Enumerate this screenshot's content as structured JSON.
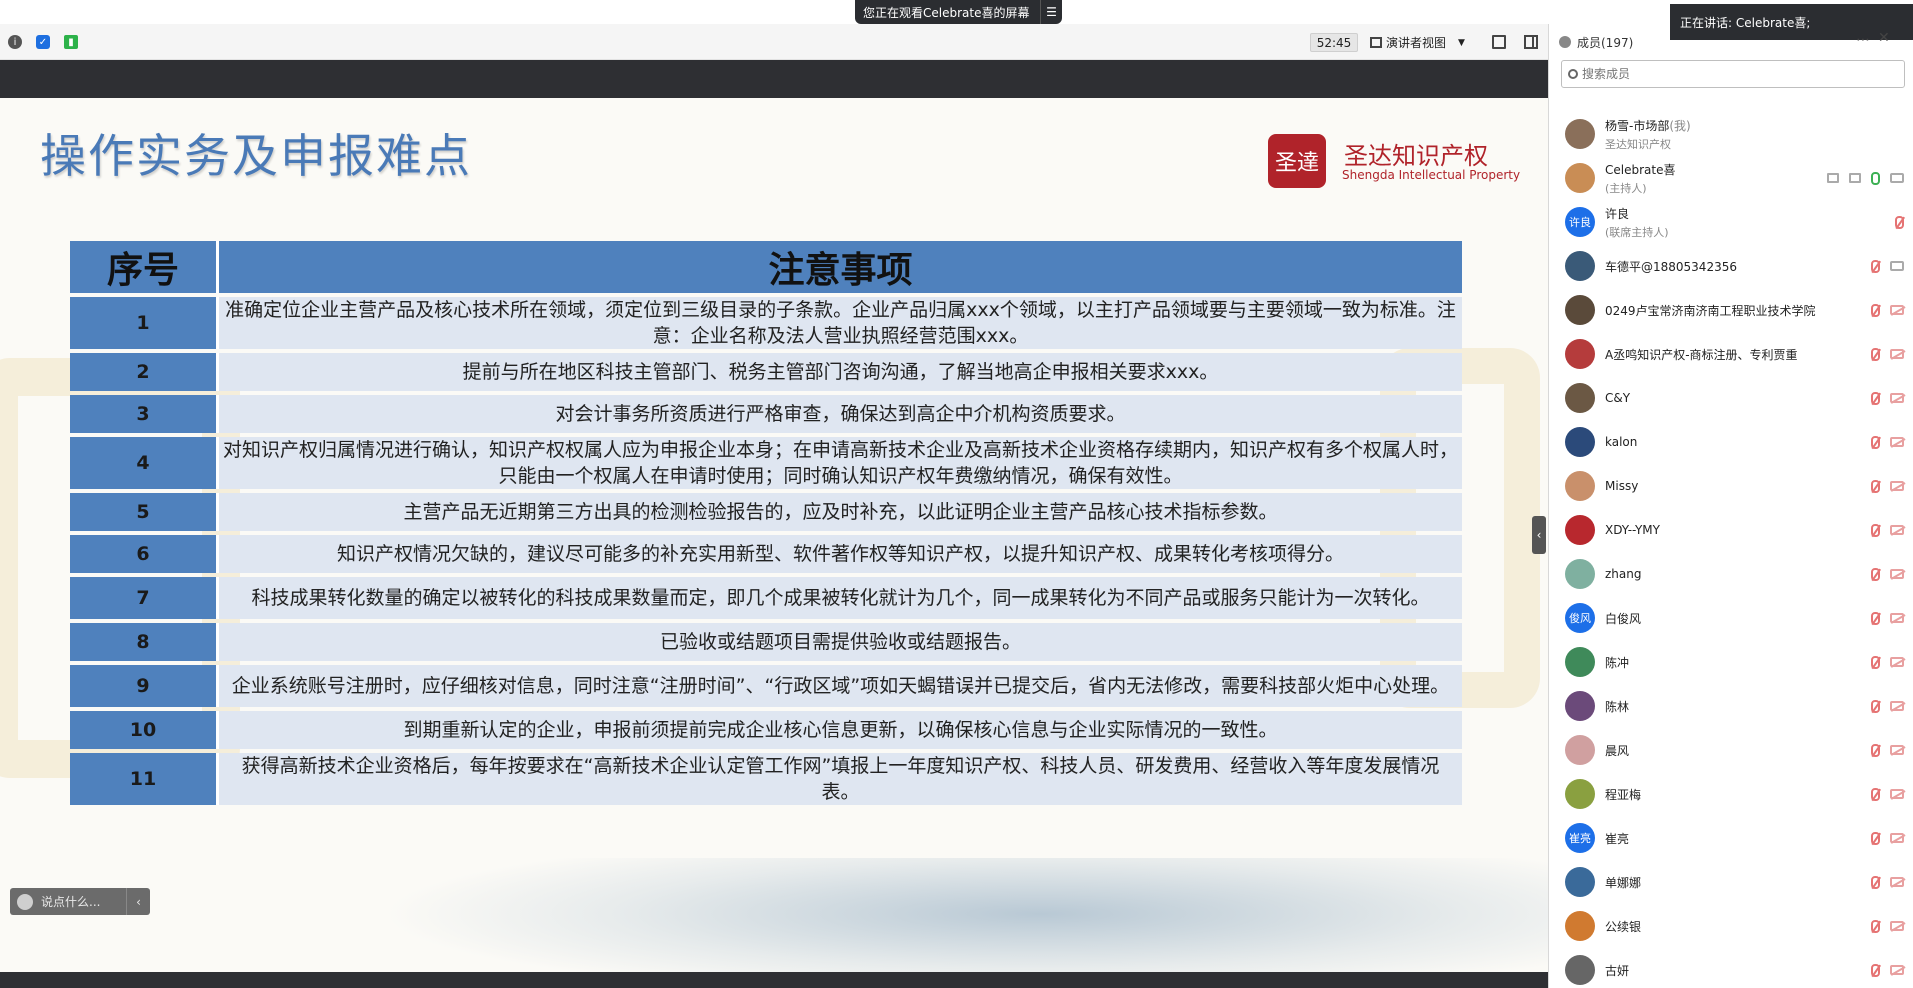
{
  "banner": {
    "text": "您正在观看Celebrate喜的屏幕"
  },
  "toolbar": {
    "timer": "52:45",
    "view_mode": "演讲者视图"
  },
  "slide": {
    "title": "操作实务及申报难点",
    "logo_cn": "圣达知识产权",
    "logo_en": "Shengda Intellectual Property",
    "logo_seal": "圣達",
    "table": {
      "headers": [
        "序号",
        "注意事项"
      ],
      "rows": [
        {
          "no": "1",
          "text": "准确定位企业主营产品及核心技术所在领域，须定位到三级目录的子条款。企业产品归属xxx个领域，以主打产品领域要与主要领域一致为标准。注意：企业名称及法人营业执照经营范围xxx。"
        },
        {
          "no": "2",
          "text": "提前与所在地区科技主管部门、税务主管部门咨询沟通，了解当地高企申报相关要求xxx。"
        },
        {
          "no": "3",
          "text": "对会计事务所资质进行严格审查，确保达到高企中介机构资质要求。"
        },
        {
          "no": "4",
          "text": "对知识产权归属情况进行确认，知识产权权属人应为申报企业本身；在申请高新技术企业及高新技术企业资格存续期内，知识产权有多个权属人时，只能由一个权属人在申请时使用；同时确认知识产权年费缴纳情况，确保有效性。"
        },
        {
          "no": "5",
          "text": "主营产品无近期第三方出具的检测检验报告的，应及时补充，以此证明企业主营产品核心技术指标参数。"
        },
        {
          "no": "6",
          "text": "知识产权情况欠缺的，建议尽可能多的补充实用新型、软件著作权等知识产权，以提升知识产权、成果转化考核项得分。"
        },
        {
          "no": "7",
          "text": "科技成果转化数量的确定以被转化的科技成果数量而定，即几个成果被转化就计为几个，同一成果转化为不同产品或服务只能计为一次转化。"
        },
        {
          "no": "8",
          "text": "已验收或结题项目需提供验收或结题报告。"
        },
        {
          "no": "9",
          "text": "企业系统账号注册时，应仔细核对信息，同时注意“注册时间”、“行政区域”项如天蝎错误并已提交后，省内无法修改，需要科技部火炬中心处理。"
        },
        {
          "no": "10",
          "text": "到期重新认定的企业，申报前须提前完成企业核心信息更新，以确保核心信息与企业实际情况的一致性。"
        },
        {
          "no": "11",
          "text": "获得高新技术企业资格后，每年按要求在“高新技术企业认定管工作网”填报上一年度知识产权、科技人员、研发费用、经营收入等年度发展情况表。"
        }
      ]
    }
  },
  "chat": {
    "placeholder": "说点什么..."
  },
  "sidebar": {
    "speaking": "正在讲话: Celebrate喜;",
    "title": "成员(197)",
    "search_placeholder": "搜索成员",
    "members": [
      {
        "name": "杨雪-市场部",
        "tag": "(我)",
        "sub": "圣达知识产权",
        "avatar": "",
        "mic": "none",
        "cam": "none"
      },
      {
        "name": "Celebrate喜",
        "tag": "",
        "sub": "(主持人)",
        "avatar": "",
        "mic": "on",
        "cam": "gray"
      },
      {
        "name": "许良",
        "tag": "",
        "sub": "(联席主持人)",
        "avatar": "许良",
        "mic": "off",
        "cam": "none"
      },
      {
        "name": "车德平@18805342356",
        "tag": "",
        "sub": "",
        "avatar": "",
        "mic": "off",
        "cam": "gray"
      },
      {
        "name": "0249卢宝常济南济南工程职业技术学院",
        "tag": "",
        "sub": "",
        "avatar": "",
        "mic": "off",
        "cam": "off"
      },
      {
        "name": "A丞鸣知识产权-商标注册、专利贾重",
        "tag": "",
        "sub": "",
        "avatar": "",
        "mic": "off",
        "cam": "off"
      },
      {
        "name": "C&Y",
        "tag": "",
        "sub": "",
        "avatar": "",
        "mic": "off",
        "cam": "off"
      },
      {
        "name": "kalon",
        "tag": "",
        "sub": "",
        "avatar": "",
        "mic": "off",
        "cam": "off"
      },
      {
        "name": "Missy",
        "tag": "",
        "sub": "",
        "avatar": "",
        "mic": "off",
        "cam": "off"
      },
      {
        "name": "XDY--YMY",
        "tag": "",
        "sub": "",
        "avatar": "",
        "mic": "off",
        "cam": "off"
      },
      {
        "name": "zhang",
        "tag": "",
        "sub": "",
        "avatar": "",
        "mic": "off",
        "cam": "off"
      },
      {
        "name": "白俊风",
        "tag": "",
        "sub": "",
        "avatar": "俊风",
        "mic": "off",
        "cam": "off"
      },
      {
        "name": "陈冲",
        "tag": "",
        "sub": "",
        "avatar": "",
        "mic": "off",
        "cam": "off"
      },
      {
        "name": "陈林",
        "tag": "",
        "sub": "",
        "avatar": "",
        "mic": "off",
        "cam": "off"
      },
      {
        "name": "晨风",
        "tag": "",
        "sub": "",
        "avatar": "",
        "mic": "off",
        "cam": "off"
      },
      {
        "name": "程亚梅",
        "tag": "",
        "sub": "",
        "avatar": "",
        "mic": "off",
        "cam": "off"
      },
      {
        "name": "崔亮",
        "tag": "",
        "sub": "",
        "avatar": "崔亮",
        "mic": "off",
        "cam": "off"
      },
      {
        "name": "单娜娜",
        "tag": "",
        "sub": "",
        "avatar": "",
        "mic": "off",
        "cam": "off"
      },
      {
        "name": "公续银",
        "tag": "",
        "sub": "",
        "avatar": "",
        "mic": "off",
        "cam": "off"
      },
      {
        "name": "古妍",
        "tag": "",
        "sub": "",
        "avatar": "",
        "mic": "off",
        "cam": "off"
      }
    ]
  }
}
